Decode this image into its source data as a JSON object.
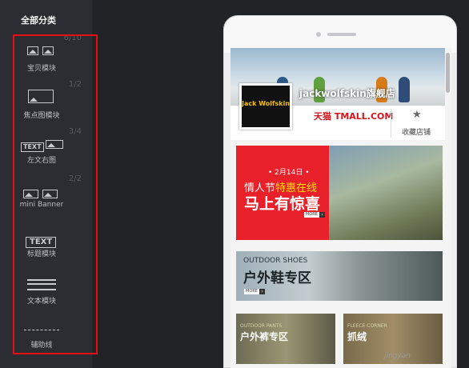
{
  "sidebar": {
    "title": "全部分类",
    "modules": [
      {
        "label": "宝贝模块",
        "count": "6/10",
        "icon": "two-image-icon"
      },
      {
        "label": "焦点图模块",
        "count": "1/2",
        "icon": "focus-image-icon"
      },
      {
        "label": "左文右图",
        "count": "3/4",
        "icon": "text-image-icon",
        "icon_text": "TEXT"
      },
      {
        "label": "mini Banner",
        "count": "2/2",
        "icon": "mini-banner-icon"
      },
      {
        "label": "标题模块",
        "icon": "title-text-icon",
        "icon_text": "TEXT"
      },
      {
        "label": "文本模块",
        "icon": "text-lines-icon"
      },
      {
        "label": "辅助线",
        "icon": "dashed-line-icon"
      }
    ]
  },
  "shop": {
    "logo_text": "Jack Wolfskin",
    "name": "jackwolfskin旗舰店",
    "platform": "天猫 TMALL.COM",
    "favorite_label": "收藏店铺"
  },
  "banners": {
    "valentine": {
      "date": "• 2月14日 •",
      "line1_prefix": "情人节",
      "line1_highlight": "特惠在线",
      "line2": "马上有惊喜",
      "more": "MORE"
    },
    "shoes": {
      "line1": "OUTDOOR SHOES",
      "line2": "户外鞋专区",
      "more": "MORE"
    },
    "pants": {
      "line1": "OUTDOOR PANTS",
      "line2": "户外裤专区"
    },
    "fleece": {
      "line1": "FLEECE CORNER",
      "line2": "抓绒"
    }
  },
  "watermark": "jingyan"
}
